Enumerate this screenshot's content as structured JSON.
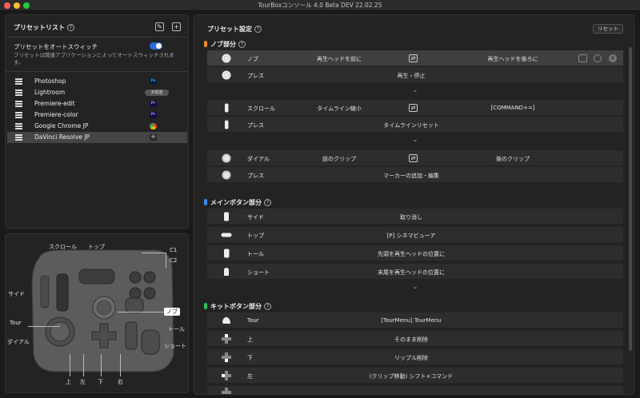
{
  "window": {
    "title": "TourBoxコンソール 4.0 Beta DEV 22.02.25"
  },
  "preset_list": {
    "title": "プリセットリスト",
    "help": "?",
    "auto_switch_label": "プリセットをオートスウィッチ",
    "auto_switch_desc": "プリセットは関連アプリケーションによってオートスウィッチされます。",
    "apps": [
      {
        "name": "Photoshop",
        "badge": "Ps",
        "badge_color": "#0b1e3a",
        "badge_text": "#31a8ff"
      },
      {
        "name": "Lightroom",
        "pill": "未関連"
      },
      {
        "name": "Premiere-edit",
        "badge": "Pr",
        "badge_color": "#1b0b3a",
        "badge_text": "#9999ff"
      },
      {
        "name": "Premiere-color",
        "badge": "Pr",
        "badge_color": "#1b0b3a",
        "badge_text": "#9999ff"
      },
      {
        "name": "Google Chrome JP",
        "badge": "",
        "badge_color": "#ffffff"
      },
      {
        "name": "DaVinci Resolve JP",
        "badge": "",
        "badge_color": "#2a2a2a",
        "selected": true
      }
    ]
  },
  "device": {
    "labels": {
      "scroll": "スクロール",
      "top": "トップ",
      "c1": "C1",
      "c2": "C2",
      "side": "サイド",
      "knob": "ノブ",
      "tour": "Tour",
      "tall": "トール",
      "dial": "ダイアル",
      "short": "ショート",
      "up": "上",
      "left": "左",
      "down": "下",
      "right": "右"
    }
  },
  "preset_settings": {
    "title": "プリセット設定",
    "help": "?",
    "reset": "リセット",
    "sections": {
      "knob": {
        "title": "ノブ部分",
        "color": "#f08a24"
      },
      "main": {
        "title": "メインボタン部分",
        "color": "#3a8fe8"
      },
      "kit": {
        "title": "キットボタン部分",
        "color": "#2fbf5a"
      }
    },
    "knob_rows": [
      {
        "name": "ノブ",
        "left": "再生ヘッドを前に",
        "right": "再生ヘッドを後ろに"
      },
      {
        "name": "プレス",
        "center": "再生・停止"
      }
    ],
    "scroll_rows": [
      {
        "name": "スクロール",
        "left": "タイムライン縮小",
        "right": "[COMMAND+=]"
      },
      {
        "name": "プレス",
        "center": "タイムラインリセット"
      }
    ],
    "dial_rows": [
      {
        "name": "ダイアル",
        "left": "前のクリップ",
        "right": "後のクリップ"
      },
      {
        "name": "プレス",
        "center": "マーカーの追加・編集"
      }
    ],
    "main_rows": [
      {
        "name": "サイド",
        "center": "取り消し"
      },
      {
        "name": "トップ",
        "center": "[P] シネマビューア"
      },
      {
        "name": "トール",
        "center": "先頭を再生ヘッドの位置に"
      },
      {
        "name": "ショート",
        "center": "末尾を再生ヘッドの位置に"
      }
    ],
    "kit_rows": [
      {
        "name": "Tour",
        "center": "[TourMenu] TourMenu"
      },
      {
        "name": "上",
        "center": "そのまま削除"
      },
      {
        "name": "下",
        "center": "リップル削除"
      },
      {
        "name": "左",
        "center": "(クリップ移動) シフト+コマンド"
      }
    ],
    "swap_glyph": "⇄",
    "chevron": "⌄"
  }
}
